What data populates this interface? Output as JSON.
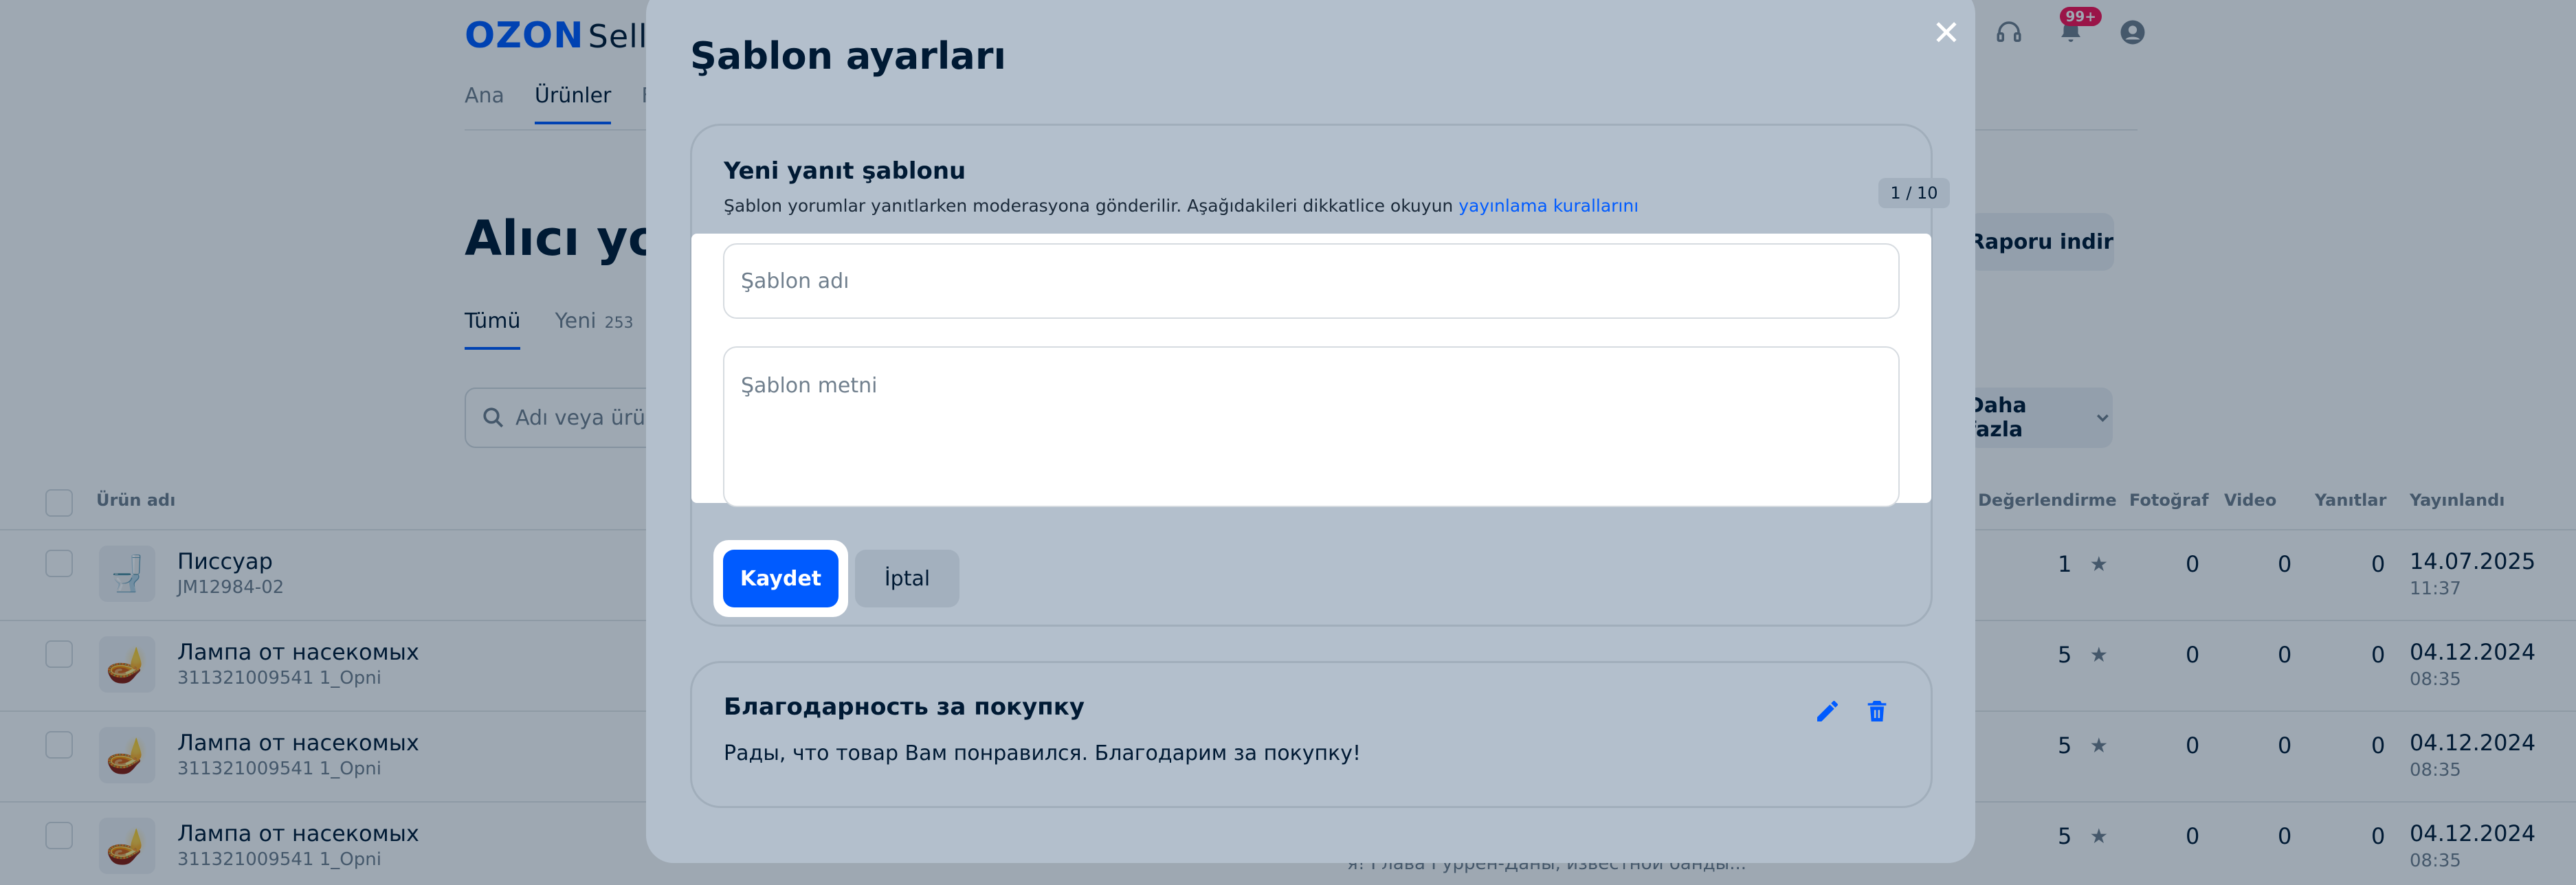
{
  "app": {
    "logo": "OZON",
    "logo_suffix": "Sell",
    "notifications_badge": "99+"
  },
  "nav": {
    "items": [
      "Ana",
      "Ürünler",
      "F"
    ],
    "active_index": 1
  },
  "page": {
    "title": "Alıcı yoru",
    "report_button": "Raporu indir",
    "tabs": [
      {
        "label": "Tümü",
        "count": ""
      },
      {
        "label": "Yeni",
        "count": "253"
      }
    ],
    "search_placeholder": "Adı veya ürün",
    "more_button": "Daha fazla"
  },
  "table": {
    "columns": {
      "product": "Ürün adı",
      "rating": "Değerlendirme",
      "photo": "Fotoğraf",
      "video": "Video",
      "replies": "Yanıtlar",
      "published": "Yayınlandı"
    },
    "rows": [
      {
        "name": "Писсуар",
        "sku": "JM12984-02",
        "rating": "1",
        "photo": "0",
        "video": "0",
        "replies": "0",
        "date": "14.07.2025",
        "time": "11:37"
      },
      {
        "name": "Лампа от насекомых",
        "sku": "311321009541 1_Opni",
        "rating": "5",
        "photo": "0",
        "video": "0",
        "replies": "0",
        "date": "04.12.2024",
        "time": "08:35"
      },
      {
        "name": "Лампа от насекомых",
        "sku": "311321009541 1_Opni",
        "rating": "5",
        "photo": "0",
        "video": "0",
        "replies": "0",
        "date": "04.12.2024",
        "time": "08:35"
      },
      {
        "name": "Лампа от насекомых",
        "sku": "311321009541 1_Opni",
        "rating": "5",
        "photo": "0",
        "video": "0",
        "replies": "0",
        "date": "04.12.2024",
        "time": "08:35"
      }
    ],
    "last_row_snippet": "я! Глава Гуррен-Даны, известной банды..."
  },
  "modal": {
    "title": "Şablon ayarları",
    "close_icon": "close-icon",
    "new_template": {
      "title": "Yeni yanıt şablonu",
      "description": "Şablon yorumlar yanıtlarken moderasyona gönderilir. Aşağıdakileri dikkatlice okuyun ",
      "link_text": "yayınlama kurallarını",
      "counter": "1 / 10",
      "name_placeholder": "Şablon adı",
      "name_value": "",
      "text_placeholder": "Şablon metni",
      "text_value": "",
      "save_label": "Kaydet",
      "cancel_label": "İptal"
    },
    "saved_template": {
      "title": "Благодарность за покупку",
      "body": "Рады, что товар Вам понравился. Благодарим за покупку!"
    }
  },
  "colors": {
    "brand": "#005bff",
    "overlay": "#001a34",
    "modal_bg": "#b3bfcc",
    "badge": "#f91155"
  }
}
